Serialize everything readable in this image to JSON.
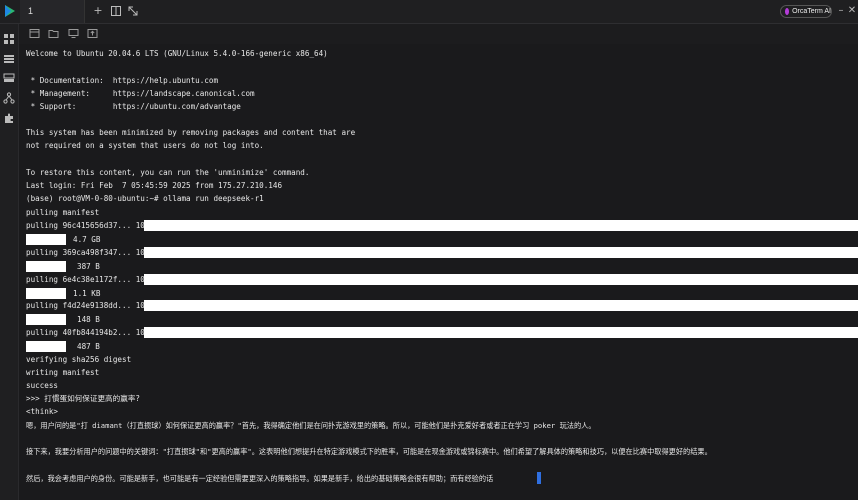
{
  "topbar": {
    "tab_label": "1",
    "ai_button_label": "OrcaTerm AI",
    "new_tab_glyph": "+",
    "split_glyph": "⫽",
    "expand_glyph": "⤡",
    "minimize_glyph": "–",
    "close_glyph": "✕"
  },
  "sidebar": {
    "icons": [
      "dashboard-icon",
      "list-icon",
      "server-icon",
      "network-icon",
      "plugin-icon"
    ]
  },
  "toolbar": {
    "icons": [
      "terminal-tab-icon",
      "folder-icon",
      "monitor-icon",
      "upload-icon"
    ]
  },
  "terminal": {
    "lines": [
      "Welcome to Ubuntu 20.04.6 LTS (GNU/Linux 5.4.0-166-generic x86_64)",
      " * Documentation:  https://help.ubuntu.com",
      " * Management:     https://landscape.canonical.com",
      " * Support:        https://ubuntu.com/advantage",
      "This system has been minimized by removing packages and content that are",
      "not required on a system that users do not log into.",
      "To restore this content, you can run the 'unminimize' command.",
      "Last login: Fri Feb  7 05:45:59 2025 from 175.27.210.146",
      "(base) root@VM-0-80-ubuntu:~# ollama run deepseek-r1",
      "pulling manifest",
      "pulling 96c415656d37... 100%",
      "4.7 GB",
      "pulling 369ca498f347... 100%",
      "387 B",
      "pulling 6e4c38e1172f... 100%",
      "1.1 KB",
      "pulling f4d24e9138dd... 100%",
      "148 B",
      "pulling 40fb844194b2... 100%",
      "487 B",
      "verifying sha256 digest",
      "writing manifest",
      "success",
      ">>> 打慣蛋如何保证更高的赢率?",
      "<think>",
      "嗯，用户问的是\"打 diamant（打直掼球）如何保证更高的赢率？\"首先，我得确定他们是在问扑克游戏里的策略。所以，可能他们是扑克爱好者或者正在学习 poker 玩法的人。",
      "接下来，我要分析用户的问题中的关键词：\"打直掼球\"和\"更高的赢率\"。这表明他们想提升在特定游戏模式下的胜率，可能是在现金游戏或锦标赛中。他们希望了解具体的策略和技巧，以便在比赛中取得更好的结果。",
      "然后，我会考虑用户的身份。可能是新手，也可能是有一定经验但需要更深入的策略指导。如果是新手，给出的基础策略会很有帮助；而有经验的话"
    ]
  }
}
